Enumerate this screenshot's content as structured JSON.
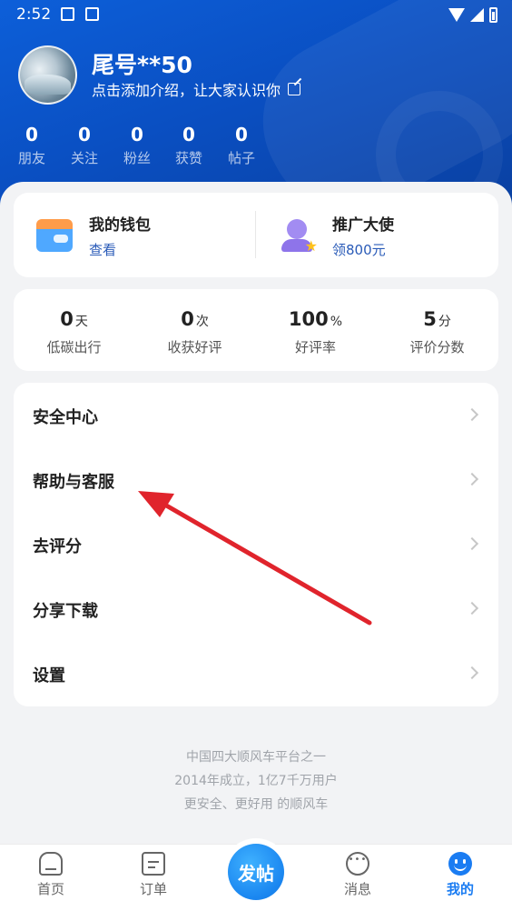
{
  "status_bar": {
    "time": "2:52"
  },
  "profile": {
    "name": "尾号**50",
    "bio": "点击添加介绍，让大家认识你"
  },
  "stats": [
    {
      "value": "0",
      "label": "朋友"
    },
    {
      "value": "0",
      "label": "关注"
    },
    {
      "value": "0",
      "label": "粉丝"
    },
    {
      "value": "0",
      "label": "获赞"
    },
    {
      "value": "0",
      "label": "帖子"
    }
  ],
  "wallet": {
    "title": "我的钱包",
    "action": "查看"
  },
  "ambassador": {
    "title": "推广大使",
    "action": "领800元"
  },
  "metrics": [
    {
      "value": "0",
      "unit": "天",
      "label": "低碳出行"
    },
    {
      "value": "0",
      "unit": "次",
      "label": "收获好评"
    },
    {
      "value": "100",
      "unit": "%",
      "label": "好评率"
    },
    {
      "value": "5",
      "unit": "分",
      "label": "评价分数"
    }
  ],
  "menu": [
    {
      "label": "安全中心"
    },
    {
      "label": "帮助与客服"
    },
    {
      "label": "去评分"
    },
    {
      "label": "分享下载"
    },
    {
      "label": "设置"
    }
  ],
  "footer": {
    "line1": "中国四大顺风车平台之一",
    "line2": "2014年成立，1亿7千万用户",
    "line3": "更安全、更好用 的顺风车"
  },
  "tabbar": {
    "home": "首页",
    "orders": "订单",
    "post": "发帖",
    "messages": "消息",
    "me": "我的",
    "active": "me"
  },
  "colors": {
    "header": "#0a4fc2",
    "accent": "#1a7cf2",
    "annotation_arrow": "#e0242c"
  }
}
